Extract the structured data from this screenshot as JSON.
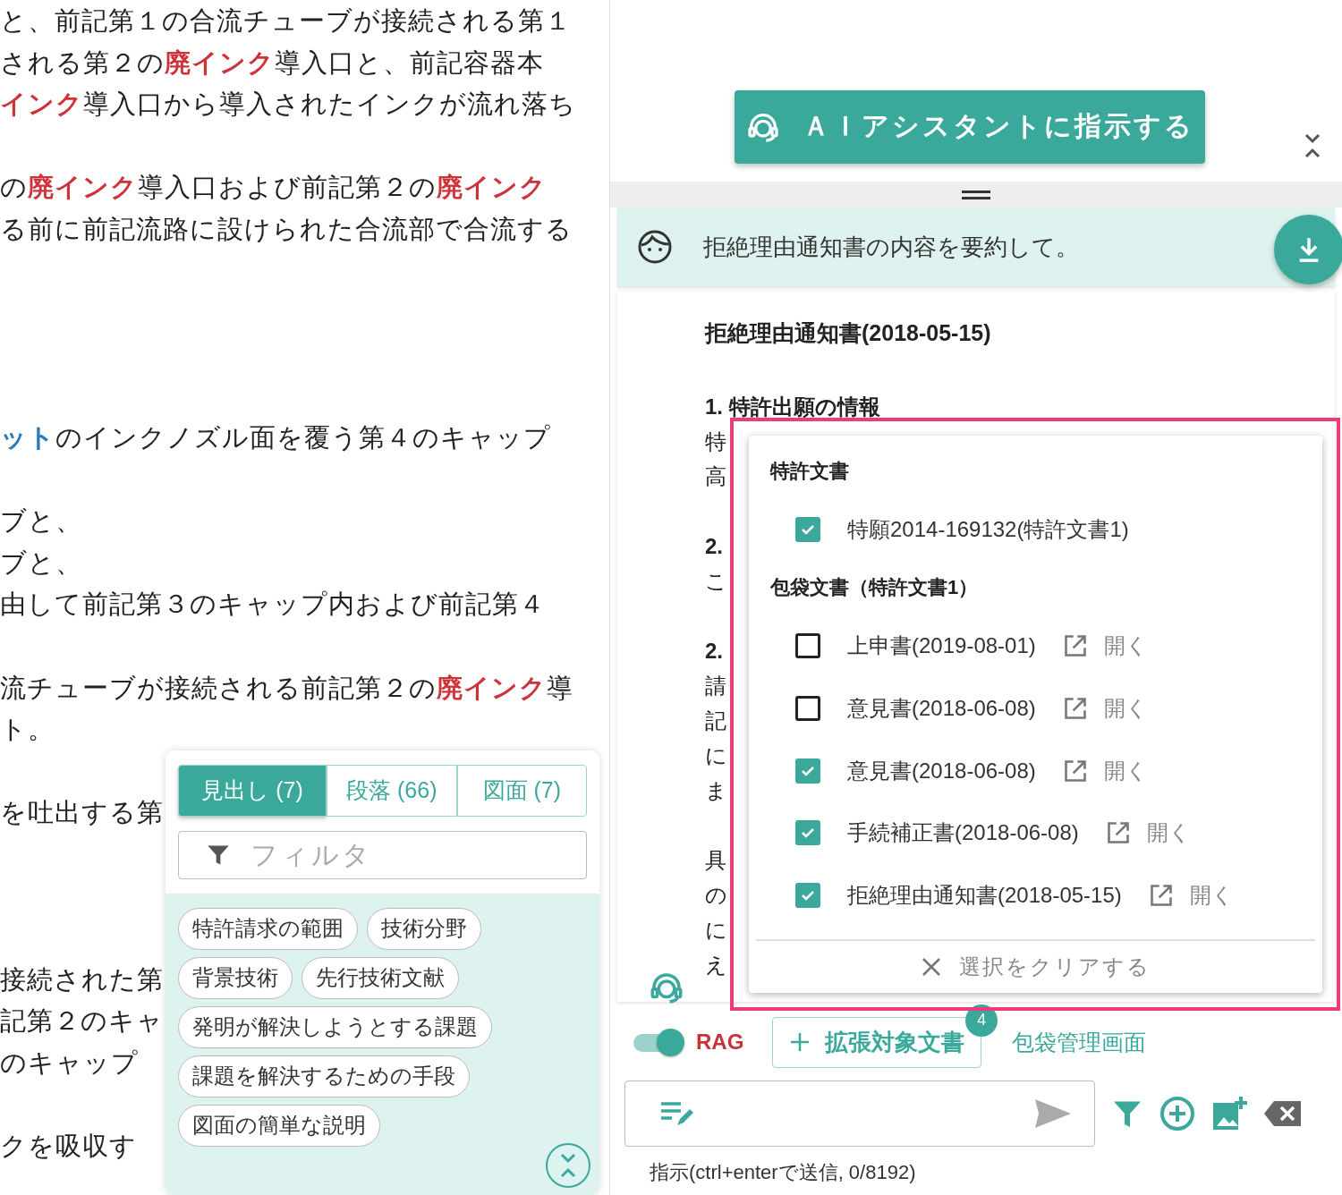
{
  "document": {
    "lines": [
      {
        "kind": "text",
        "segments": [
          {
            "kind": "plain",
            "text": "と、前記第１の合流チューブが接続される第１"
          }
        ]
      },
      {
        "kind": "text",
        "segments": [
          {
            "kind": "plain",
            "text": "される第２の"
          },
          {
            "kind": "term",
            "text": "廃インク"
          },
          {
            "kind": "plain",
            "text": "導入口と、前記容器本"
          }
        ]
      },
      {
        "kind": "text",
        "segments": [
          {
            "kind": "term",
            "text": "インク"
          },
          {
            "kind": "plain",
            "text": "導入口から導入されたインクが流れ落ち"
          }
        ]
      },
      {
        "kind": "gap"
      },
      {
        "kind": "text",
        "segments": [
          {
            "kind": "plain",
            "text": "の"
          },
          {
            "kind": "term",
            "text": "廃インク"
          },
          {
            "kind": "plain",
            "text": "導入口および前記第２の"
          },
          {
            "kind": "term",
            "text": "廃インク"
          }
        ]
      },
      {
        "kind": "text",
        "segments": [
          {
            "kind": "plain",
            "text": "る前に前記流路に設けられた合流部で合流する"
          }
        ]
      },
      {
        "kind": "gap"
      },
      {
        "kind": "gap"
      },
      {
        "kind": "gap"
      },
      {
        "kind": "gap"
      },
      {
        "kind": "text",
        "segments": [
          {
            "kind": "link",
            "text": "ット"
          },
          {
            "kind": "plain",
            "text": "のインクノズル面を覆う第４のキャップ"
          }
        ]
      },
      {
        "kind": "gap"
      },
      {
        "kind": "text",
        "segments": [
          {
            "kind": "plain",
            "text": "ブと、"
          }
        ]
      },
      {
        "kind": "text",
        "segments": [
          {
            "kind": "plain",
            "text": "ブと、"
          }
        ]
      },
      {
        "kind": "text",
        "segments": [
          {
            "kind": "plain",
            "text": "由して前記第３のキャップ内および前記第４"
          }
        ]
      },
      {
        "kind": "gap"
      },
      {
        "kind": "text",
        "segments": [
          {
            "kind": "plain",
            "text": "流チューブが接続される前記第２の"
          },
          {
            "kind": "term",
            "text": "廃インク"
          },
          {
            "kind": "plain",
            "text": "導"
          }
        ]
      },
      {
        "kind": "text",
        "segments": [
          {
            "kind": "plain",
            "text": "ト。"
          }
        ]
      }
    ],
    "lower_lines": [
      {
        "kind": "gap"
      },
      {
        "kind": "text",
        "segments": [
          {
            "kind": "plain",
            "text": "を吐出する第"
          }
        ]
      },
      {
        "kind": "gap"
      },
      {
        "kind": "gap"
      },
      {
        "kind": "gap"
      },
      {
        "kind": "text",
        "segments": [
          {
            "kind": "plain",
            "text": "接続された第"
          }
        ]
      },
      {
        "kind": "text",
        "segments": [
          {
            "kind": "plain",
            "text": "記第２のキャ"
          }
        ]
      },
      {
        "kind": "text",
        "segments": [
          {
            "kind": "plain",
            "text": "のキャップ"
          }
        ]
      },
      {
        "kind": "gap"
      },
      {
        "kind": "text",
        "segments": [
          {
            "kind": "plain",
            "text": "クを吸収す"
          }
        ]
      }
    ]
  },
  "outline_panel": {
    "tabs": [
      {
        "label": "見出し (7)",
        "selected": true
      },
      {
        "label": "段落 (66)",
        "selected": false
      },
      {
        "label": "図面 (7)",
        "selected": false
      }
    ],
    "filter": {
      "placeholder": "フィルタ"
    },
    "chips": [
      "特許請求の範囲",
      "技術分野",
      "背景技術",
      "先行技術文献",
      "発明が解決しようとする課題",
      "課題を解決するための手段",
      "図面の簡単な説明"
    ]
  },
  "assistant": {
    "ai_button": "ＡＩアシスタントに指示する",
    "prompt": "拒絶理由通知書の内容を要約して。",
    "answer": {
      "title": "拒絶理由通知書(2018-05-15)",
      "lines": [
        {
          "kind": "gap"
        },
        {
          "kind": "heading",
          "text": "1. 特許出願の情報"
        },
        {
          "kind": "text",
          "text": "特"
        },
        {
          "kind": "text",
          "text": "高"
        },
        {
          "kind": "gap"
        },
        {
          "kind": "heading",
          "text": "2."
        },
        {
          "kind": "text",
          "text": "こ"
        },
        {
          "kind": "gap"
        },
        {
          "kind": "heading",
          "text": "2."
        },
        {
          "kind": "text",
          "text": "請"
        },
        {
          "kind": "text",
          "text": "記"
        },
        {
          "kind": "text",
          "text": "に"
        },
        {
          "kind": "text",
          "text": "ま"
        },
        {
          "kind": "gap"
        },
        {
          "kind": "text",
          "text": "具"
        },
        {
          "kind": "text",
          "text": "の"
        },
        {
          "kind": "text",
          "text": "に"
        },
        {
          "kind": "text",
          "text": "え"
        }
      ]
    },
    "document_menu": {
      "sections": [
        {
          "heading": "特許文書",
          "items": [
            {
              "label": "特願2014-169132(特許文書1)",
              "checked": true
            }
          ]
        },
        {
          "heading": "包袋文書（特許文書1）",
          "items": [
            {
              "label": "上申書(2019-08-01)",
              "checked": false,
              "open_label": "開く"
            },
            {
              "label": "意見書(2018-06-08)",
              "checked": false,
              "open_label": "開く"
            },
            {
              "label": "意見書(2018-06-08)",
              "checked": true,
              "open_label": "開く"
            },
            {
              "label": "手続補正書(2018-06-08)",
              "checked": true,
              "open_label": "開く"
            },
            {
              "label": "拒絶理由通知書(2018-05-15)",
              "checked": true,
              "open_label": "開く"
            }
          ]
        }
      ],
      "clear_label": "選択をクリアする"
    },
    "rag": {
      "label": "RAG",
      "on": true
    },
    "extend_button": {
      "label": "拡張対象文書",
      "badge": "4"
    },
    "manage_link": "包袋管理画面",
    "input": {
      "hint": "指示(ctrl+enterで送信, 0/8192)"
    }
  }
}
